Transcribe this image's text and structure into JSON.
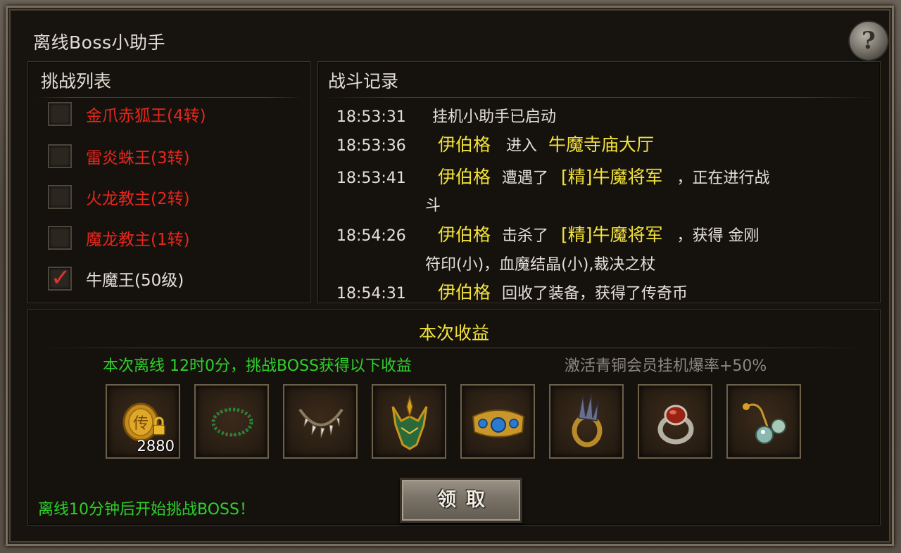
{
  "window": {
    "title": "离线Boss小助手",
    "help_icon": "question-icon",
    "help_glyph": "?"
  },
  "challenge_list": {
    "title": "挑战列表",
    "items": [
      {
        "label": "金爪赤狐王(4转)",
        "checked": false,
        "color": "#e8261c"
      },
      {
        "label": "雷炎蛛王(3转)",
        "checked": false,
        "color": "#e8261c"
      },
      {
        "label": "火龙教主(2转)",
        "checked": false,
        "color": "#e8261c"
      },
      {
        "label": "魔龙教主(1转)",
        "checked": false,
        "color": "#e8261c"
      },
      {
        "label": "牛魔王(50级)",
        "checked": true,
        "color": "#e4e0d8"
      }
    ],
    "checkmark_glyph": "✓"
  },
  "battle_log": {
    "title": "战斗记录",
    "entries": [
      {
        "time": "18:53:31",
        "text": "挂机小助手已启动"
      },
      {
        "time": "18:53:36",
        "actor": "伊伯格",
        "action": "进入",
        "target": "牛魔寺庙大厅"
      },
      {
        "time": "18:53:41",
        "actor": "伊伯格",
        "action": "遭遇了",
        "target": "[精]牛魔将军",
        "suffix": "，正在进行战",
        "cont": "斗"
      },
      {
        "time": "18:54:26",
        "actor": "伊伯格",
        "action": "击杀了",
        "target": "[精]牛魔将军",
        "suffix": "，获得 金刚",
        "cont": "符印(小)，血魔结晶(小),裁决之杖"
      },
      {
        "time": "18:54:31",
        "actor": "伊伯格",
        "action": "回收了装备，获得了传奇币"
      }
    ]
  },
  "income": {
    "title": "本次收益",
    "summary": "本次离线 12时0分，挑战BOSS获得以下收益",
    "vip_hint": "激活青铜会员挂机爆率+50%",
    "items": [
      {
        "icon": "legend-coin-icon",
        "coin_char": "传",
        "count": "2880",
        "locked": true
      },
      {
        "icon": "jade-bead-necklace-icon"
      },
      {
        "icon": "fang-necklace-icon"
      },
      {
        "icon": "horned-helmet-icon"
      },
      {
        "icon": "gem-bracelet-icon"
      },
      {
        "icon": "spiked-ring-icon"
      },
      {
        "icon": "ruby-ring-icon"
      },
      {
        "icon": "gem-earring-icon"
      }
    ],
    "claim_label": "领取",
    "footer_note": "离线10分钟后开始挑战BOSS！"
  },
  "colors": {
    "yellow": "#f2e23a",
    "green": "#2fd12b",
    "red": "#e8261c",
    "gray": "#8c887f"
  }
}
